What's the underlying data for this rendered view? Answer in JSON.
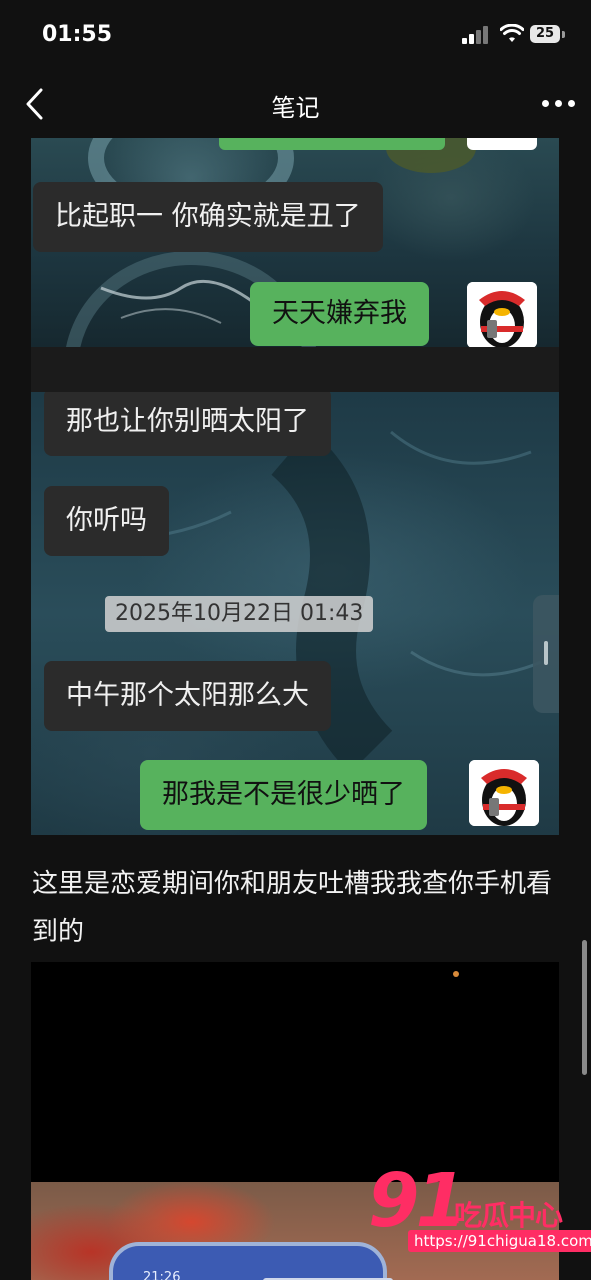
{
  "status_bar": {
    "time": "01:55",
    "battery": "25"
  },
  "nav": {
    "title": "笔记"
  },
  "screenshot1": {
    "messages": [
      {
        "side": "in",
        "text": "比起职一 你确实就是丑了"
      },
      {
        "side": "out",
        "text": "天天嫌弃我"
      }
    ]
  },
  "screenshot2": {
    "messages": [
      {
        "side": "in",
        "text": "那也让你别晒太阳了"
      },
      {
        "side": "in",
        "text": "你听吗"
      },
      {
        "side": "in",
        "text": "中午那个太阳那么大"
      },
      {
        "side": "out",
        "text": "那我是不是很少晒了"
      }
    ],
    "date_stamp": "2025年10月22日 01:43"
  },
  "caption": "这里是恋爱期间你和朋友吐槽我我查你手机看到的",
  "video": {
    "phone_time": "21:26"
  },
  "watermark": {
    "number": "91",
    "name": "吃瓜中心",
    "url": "https://91chigua18.com"
  }
}
